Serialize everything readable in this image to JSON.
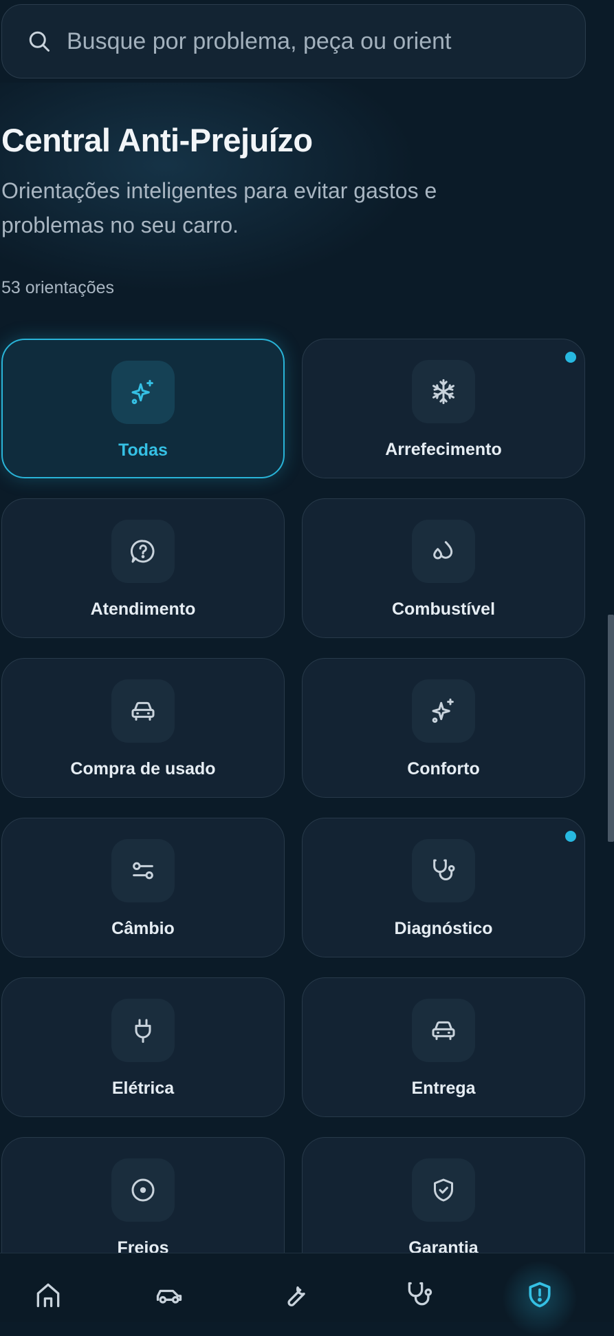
{
  "search": {
    "placeholder": "Busque por problema, peça ou orient"
  },
  "header": {
    "title": "Central Anti-Prejuízo",
    "subtitle": "Orientações inteligentes para evitar gastos e problemas no seu carro.",
    "count": "53 orientações"
  },
  "categories": [
    {
      "label": "Todas",
      "icon": "sparkles-icon",
      "active": true
    },
    {
      "label": "Arrefecimento",
      "icon": "snowflake-icon",
      "badge": true
    },
    {
      "label": "Atendimento",
      "icon": "help-circle-icon"
    },
    {
      "label": "Combustível",
      "icon": "droplets-icon"
    },
    {
      "label": "Compra de usado",
      "icon": "car-icon"
    },
    {
      "label": "Conforto",
      "icon": "sparkles-icon"
    },
    {
      "label": "Câmbio",
      "icon": "gear-shift-icon"
    },
    {
      "label": "Diagnóstico",
      "icon": "stethoscope-icon",
      "badge": true
    },
    {
      "label": "Elétrica",
      "icon": "plug-icon"
    },
    {
      "label": "Entrega",
      "icon": "car-icon"
    },
    {
      "label": "Freios",
      "icon": "brake-disc-icon"
    },
    {
      "label": "Garantia",
      "icon": "shield-check-icon"
    }
  ],
  "bottom_nav": [
    {
      "icon": "home-icon"
    },
    {
      "icon": "car-icon"
    },
    {
      "icon": "wrench-icon"
    },
    {
      "icon": "stethoscope-icon"
    },
    {
      "icon": "shield-alert-icon",
      "active": true
    }
  ],
  "colors": {
    "accent": "#29b4d8",
    "background": "#0b1b28",
    "card": "#132333"
  }
}
